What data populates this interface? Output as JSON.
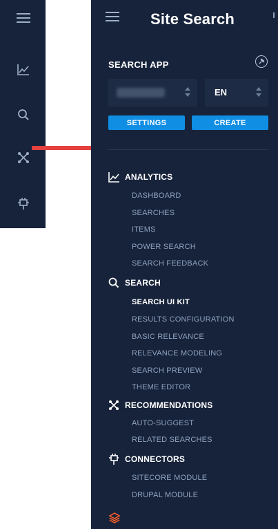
{
  "panel": {
    "title": "Site Search",
    "section_label": "SEARCH APP",
    "app_select_value": "",
    "lang_select_value": "EN",
    "settings_label": "SETTINGS",
    "create_label": "CREATE"
  },
  "nav": {
    "analytics": {
      "label": "ANALYTICS",
      "icon": "chart-line-icon",
      "items": [
        "DASHBOARD",
        "SEARCHES",
        "ITEMS",
        "POWER SEARCH",
        "SEARCH FEEDBACK"
      ]
    },
    "search": {
      "label": "SEARCH",
      "icon": "search-icon",
      "items": [
        "SEARCH UI KIT",
        "RESULTS CONFIGURATION",
        "BASIC RELEVANCE",
        "RELEVANCE MODELING",
        "SEARCH PREVIEW",
        "THEME EDITOR"
      ]
    },
    "recommendations": {
      "label": "RECOMMENDATIONS",
      "icon": "network-icon",
      "items": [
        "AUTO-SUGGEST",
        "RELATED SEARCHES"
      ]
    },
    "connectors": {
      "label": "CONNECTORS",
      "icon": "plug-icon",
      "items": [
        "SITECORE MODULE",
        "DRUPAL MODULE"
      ]
    }
  },
  "rail": {
    "icons": [
      "menu-icon",
      "chart-line-icon",
      "search-icon",
      "network-icon",
      "plug-icon"
    ]
  },
  "colors": {
    "sidebar_bg": "#17233a",
    "accent_button": "#0f8ee4",
    "active_item": "#ffffff",
    "inactive_item": "#8ea2c0",
    "annotation_arrow": "#e5413f",
    "layers_icon": "#f05a28"
  }
}
